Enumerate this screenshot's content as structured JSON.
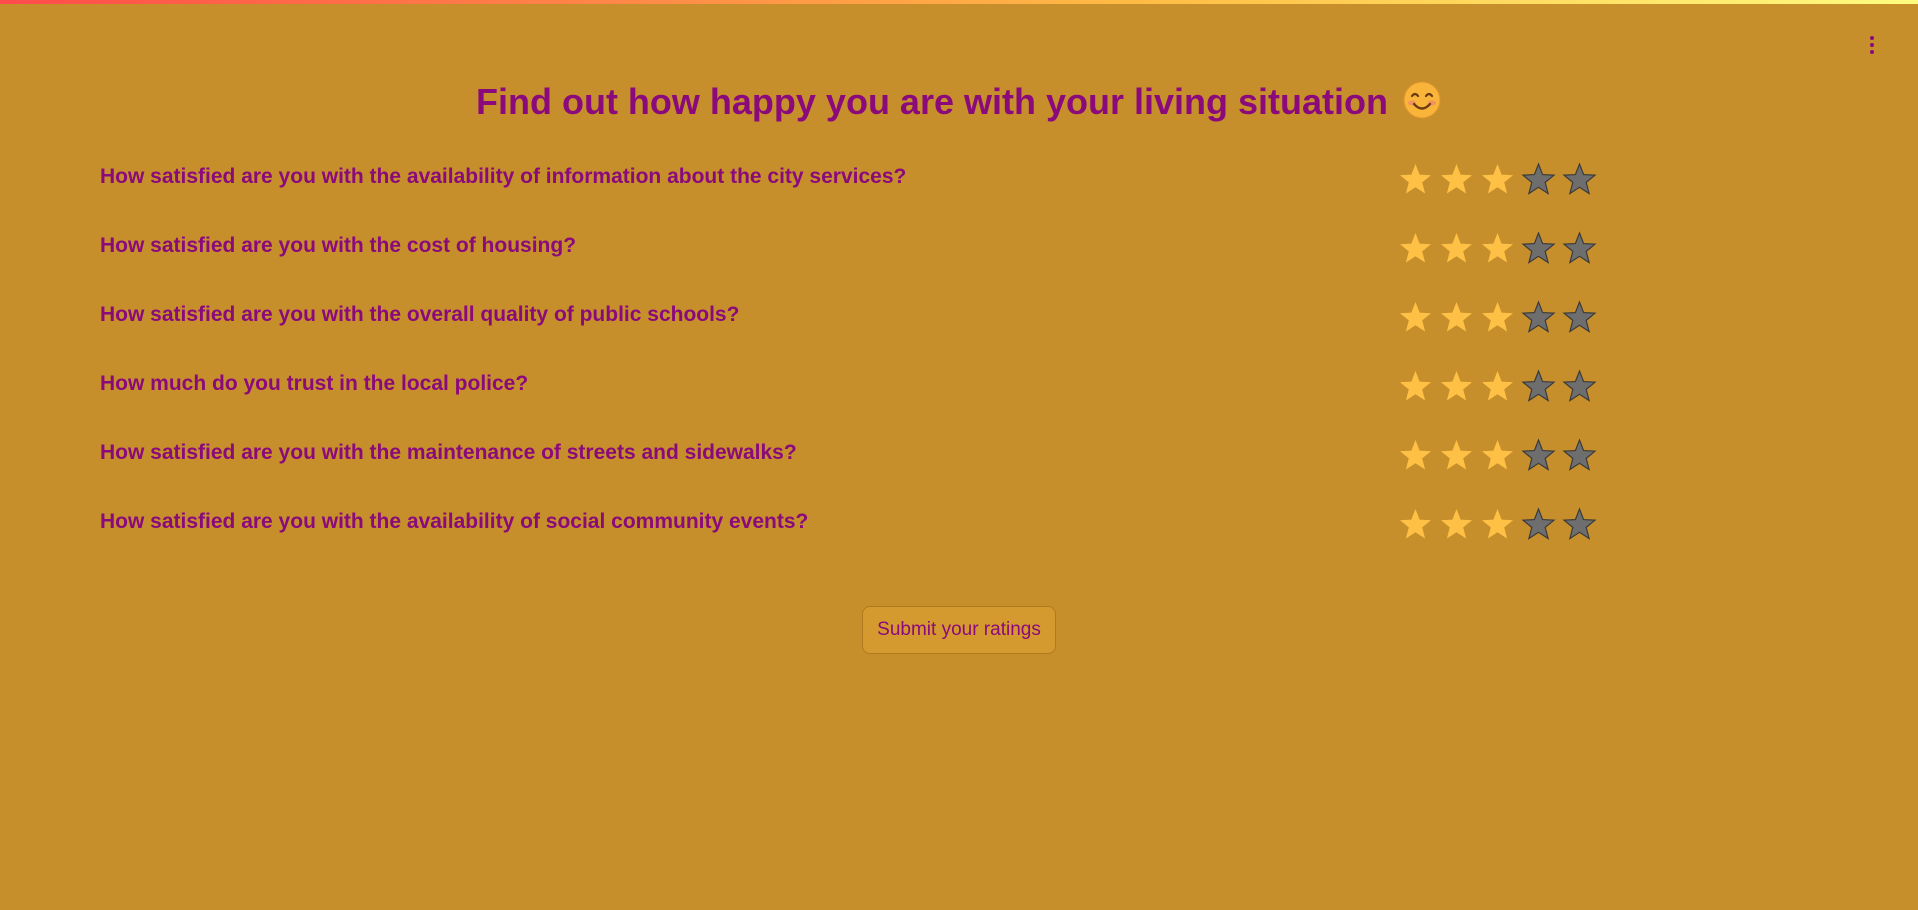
{
  "page": {
    "title": "Find out how happy you are with your living situation",
    "title_emoji": "smiling-face-emoji",
    "accent_color": "#8b0a7b",
    "background_color": "#c68f2c",
    "star_filled_color": "#ffc145",
    "star_empty_color": "#6e6e6e"
  },
  "questions": [
    {
      "text": "How satisfied are you with the availability of information about the city services?",
      "rating": 3,
      "max": 5
    },
    {
      "text": "How satisfied are you with the cost of housing?",
      "rating": 3,
      "max": 5
    },
    {
      "text": "How satisfied are you with the overall quality of public schools?",
      "rating": 3,
      "max": 5
    },
    {
      "text": "How much do you trust in the local police?",
      "rating": 3,
      "max": 5
    },
    {
      "text": "How satisfied are you with the maintenance of streets and sidewalks?",
      "rating": 3,
      "max": 5
    },
    {
      "text": "How satisfied are you with the availability of social community events?",
      "rating": 3,
      "max": 5
    }
  ],
  "submit": {
    "label": "Submit your ratings"
  },
  "menu": {
    "icon": "vertical-ellipsis-icon"
  }
}
